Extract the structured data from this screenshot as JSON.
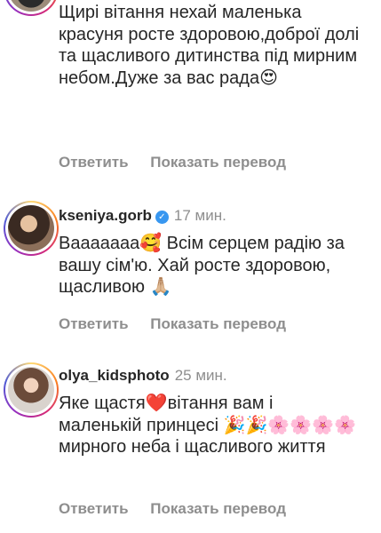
{
  "comments": [
    {
      "username": "",
      "time": "",
      "verified": false,
      "text": "Щирі вітання нехай маленька красуня росте здоровою,доброї долі та щасливого дитинства під мирним небом.Дуже за вас рада😍",
      "reply_label": "Ответить",
      "translate_label": "Показать перевод"
    },
    {
      "username": "kseniya.gorb",
      "time": "17 мин.",
      "verified": true,
      "verified_glyph": "✓",
      "text": "Вааааааа🥰 Всім серцем радію за вашу сім'ю. Хай росте здоровою, щасливою 🙏🏼",
      "reply_label": "Ответить",
      "translate_label": "Показать перевод"
    },
    {
      "username": "olya_kidsphoto",
      "time": "25 мин.",
      "verified": false,
      "text": "Яке щастя❤️вітання вам і маленькій принцесі 🎉🎉🌸🌸🌸🌸мирного неба і щасливого життя",
      "reply_label": "Ответить",
      "translate_label": "Показать перевод"
    }
  ]
}
